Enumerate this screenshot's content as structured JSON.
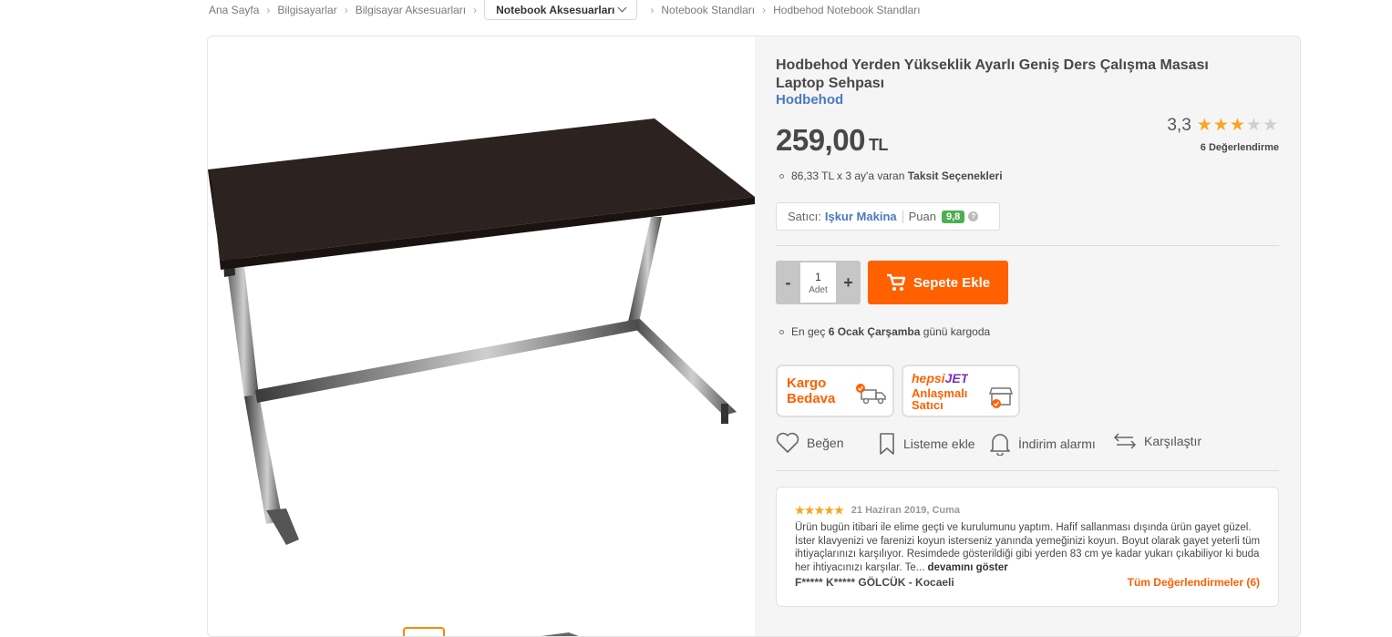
{
  "breadcrumb": {
    "items": [
      "Ana Sayfa",
      "Bilgisayarlar",
      "Bilgisayar Aksesuarları"
    ],
    "dropdown": "Notebook Aksesuarları",
    "after": [
      "Notebook Standları",
      "Hodbehod Notebook Standları"
    ]
  },
  "product": {
    "title": "Hodbehod Yerden Yükseklik Ayarlı Geniş Ders Çalışma Masası Laptop Sehpası",
    "brand": "Hodbehod",
    "price": "259,00",
    "currency": "TL",
    "rating_score": "3,3",
    "rating_stars": 3,
    "rating_count": "6 Değerlendirme",
    "installment_text": "86,33 TL x 3 ay'a varan",
    "installment_link": "Taksit Seçenekleri"
  },
  "seller": {
    "label": "Satıcı:",
    "name": "Işkur Makina",
    "score_label": "Puan",
    "score": "9,8",
    "help": "?"
  },
  "purchase": {
    "minus": "-",
    "plus": "+",
    "quantity": "1",
    "quantity_label": "Adet",
    "cart_button": "Sepete Ekle"
  },
  "delivery": {
    "prefix": "En geç",
    "date": "6 Ocak Çarşamba",
    "suffix": "günü kargoda"
  },
  "badges": {
    "free_shipping_1": "Kargo",
    "free_shipping_2": "Bedava",
    "hepsijet_logo": "hepsiJET",
    "hepsijet_1": "Anlaşmalı",
    "hepsijet_2": "Satıcı"
  },
  "actions": {
    "like": "Beğen",
    "list": "Listeme ekle",
    "alarm": "İndirim alarmı",
    "compare": "Karşılaştır"
  },
  "review": {
    "stars": "★★★★★",
    "date": "21 Haziran 2019, Cuma",
    "text": "Ürün bugün itibari ile elime geçti ve kurulumunu yaptım. Hafif sallanması dışında ürün gayet güzel. İster klavyenizi ve farenizi koyun isterseniz yanında yemeğinizi koyun. Boyut olarak gayet yeterli tüm ihtiyaçlarınızı karşılıyor. Resimdede gösterildiği gibi yerden 83 cm ye kadar yukarı çıkabiliyor ki buda her ihtiyacınızı karşılar. Te...",
    "more": "devamını göster",
    "author": "F***** K***** GÖLCÜK - Kocaeli",
    "all_reviews": "Tüm Değerlendirmeler (6)"
  },
  "colors": {
    "accent": "#ff6000",
    "link": "#4b7ac0",
    "star": "#f5a623",
    "score_green": "#4caf50"
  }
}
